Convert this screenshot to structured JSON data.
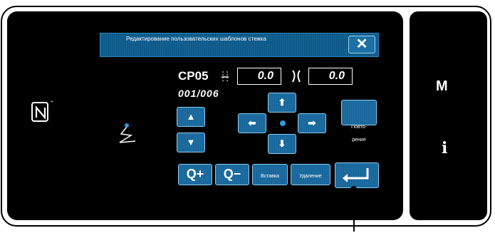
{
  "dialog": {
    "title": "Редактирование пользовательских шаблонов стежка",
    "close_label": "✕"
  },
  "pattern": {
    "code": "CP05",
    "pitch_icon": "stitch-pitch-icon",
    "pitch_value": "0.0",
    "width_icon": "stitch-width-icon",
    "width_value": "0.0",
    "counter": "001/006"
  },
  "nav": {
    "up_icon": "triangle-up-icon",
    "up": "▲",
    "down_icon": "triangle-down-icon",
    "down": "▼",
    "arrow_up": "⬆",
    "arrow_down": "⬇",
    "arrow_left": "⬅",
    "arrow_right": "➡"
  },
  "actions": {
    "repeat_label": "Повто-\nрение",
    "zoom_in_label": "Q+",
    "zoom_out_label": "Q−",
    "insert_label": "Вставка",
    "delete_label": "Удаление",
    "enter_icon": "enter-icon"
  },
  "side": {
    "m_label": "M",
    "info_label": "i"
  },
  "colors": {
    "accent": "#17679c",
    "border": "#8ccaf0",
    "dot": "#2b9be0"
  }
}
